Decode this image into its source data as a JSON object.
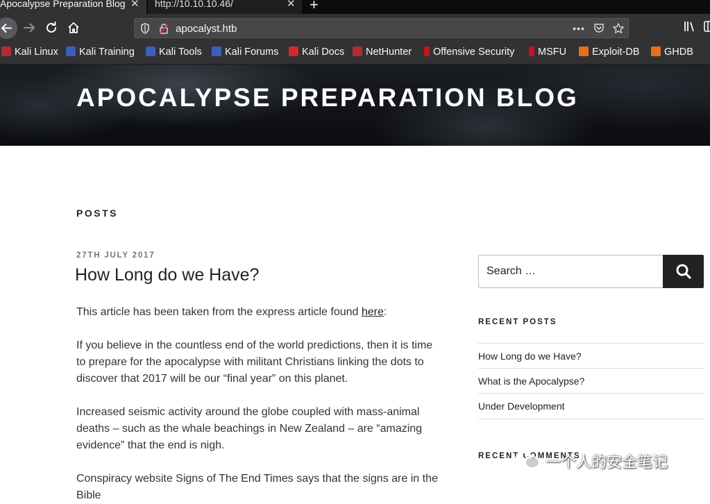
{
  "browser": {
    "tabs": [
      {
        "label": "Apocalypse Preparation Blog",
        "active": true
      },
      {
        "label": "http://10.10.10.46/",
        "active": false
      }
    ],
    "url": "apocalyst.htb",
    "bookmarks": [
      {
        "label": "Kali Linux",
        "icon": "kali-dragon-icon"
      },
      {
        "label": "Kali Training",
        "icon": "kali-training-icon"
      },
      {
        "label": "Kali Tools",
        "icon": "kali-tools-icon"
      },
      {
        "label": "Kali Forums",
        "icon": "kali-forums-icon"
      },
      {
        "label": "Kali Docs",
        "icon": "kali-docs-icon"
      },
      {
        "label": "NetHunter",
        "icon": "nethunter-icon"
      },
      {
        "label": "Offensive Security",
        "icon": "offsec-icon"
      },
      {
        "label": "MSFU",
        "icon": "msfu-icon"
      },
      {
        "label": "Exploit-DB",
        "icon": "exploit-db-icon"
      },
      {
        "label": "GHDB",
        "icon": "ghdb-icon"
      }
    ]
  },
  "site": {
    "title": "APOCALYPSE PREPARATION BLOG"
  },
  "main": {
    "posts_heading": "POSTS",
    "post": {
      "date": "27TH JULY 2017",
      "title": "How Long do we Have?",
      "intro_before_link": "This article has been taken from the express article found ",
      "intro_link": "here",
      "intro_after_link": ":",
      "paragraphs": [
        "If you believe in the countless end of the world predictions, then it is time to prepare for the apocalypse with militant Christians linking the dots to discover that 2017 will be our “final year” on this planet.",
        "Increased seismic activity around the globe coupled with mass-animal deaths – such as the whale beachings in New Zealand – are “amazing evidence” that the end is nigh.",
        "Conspiracy website Signs of The End Times says that the signs are in the Bible"
      ]
    }
  },
  "sidebar": {
    "search_placeholder": "Search …",
    "recent_posts_title": "RECENT POSTS",
    "recent_posts": [
      "How Long do we Have?",
      "What is the Apocalypse?",
      "Under Development"
    ],
    "recent_comments_title": "RECENT COMMENTS"
  },
  "watermark": "一个人的安全笔记",
  "colors": {
    "browser_chrome": "#323234",
    "tab_strip": "#0c0c0d",
    "search_button": "#222222",
    "text": "#333333"
  }
}
